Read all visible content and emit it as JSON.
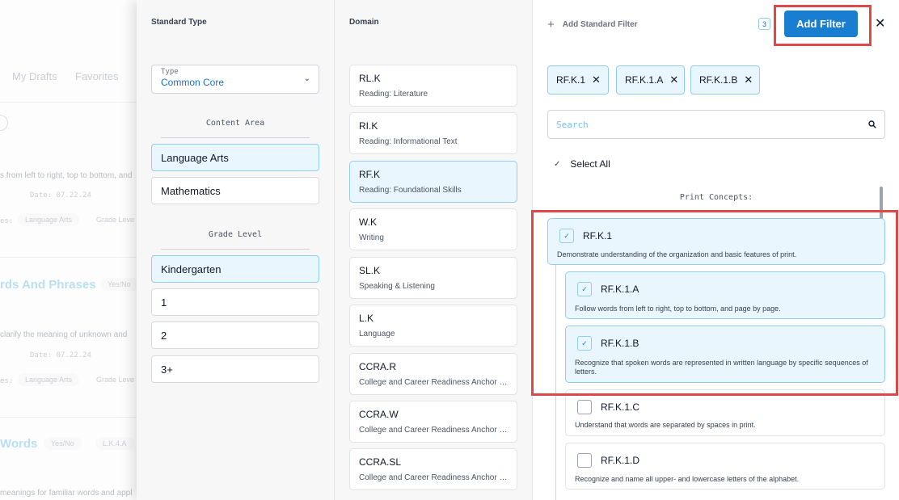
{
  "background": {
    "tabs": [
      "My Drafts",
      "Favorites"
    ],
    "lines": [
      {
        "text": "s from left to right, top to bottom, and",
        "style": "text"
      },
      {
        "text": "Date: 07.22.24",
        "style": "mono"
      },
      {
        "text": "es: ",
        "style": "mono"
      },
      {
        "text": "rds And Phrases",
        "style": "title"
      },
      {
        "text": "clarify the meaning of unknown and",
        "style": "text"
      },
      {
        "text": "Date: 07.22.24",
        "style": "mono"
      },
      {
        "text": "es: ",
        "style": "mono"
      },
      {
        "text": "Words",
        "style": "title"
      },
      {
        "text": "meanings for familiar words and appl",
        "style": "text"
      }
    ],
    "chips": [
      "Language Arts",
      "Grade Leve",
      "Yes/No",
      "Language Arts",
      "Grade Leve",
      "Yes/No",
      "L.K.4.A"
    ]
  },
  "standard_type": {
    "header": "Standard Type",
    "type_select": {
      "label": "Type",
      "value": "Common Core"
    },
    "content_area": {
      "label": "Content Area",
      "options": [
        {
          "label": "Language Arts",
          "selected": true
        },
        {
          "label": "Mathematics",
          "selected": false
        }
      ]
    },
    "grade_level": {
      "label": "Grade Level",
      "options": [
        {
          "label": "Kindergarten",
          "selected": true
        },
        {
          "label": "1",
          "selected": false
        },
        {
          "label": "2",
          "selected": false
        },
        {
          "label": "3+",
          "selected": false
        }
      ]
    }
  },
  "domain": {
    "header": "Domain",
    "items": [
      {
        "code": "RL.K",
        "desc": "Reading: Literature",
        "selected": false
      },
      {
        "code": "RI.K",
        "desc": "Reading: Informational Text",
        "selected": false
      },
      {
        "code": "RF.K",
        "desc": "Reading: Foundational Skills",
        "selected": true
      },
      {
        "code": "W.K",
        "desc": "Writing",
        "selected": false
      },
      {
        "code": "SL.K",
        "desc": "Speaking & Listening",
        "selected": false
      },
      {
        "code": "L.K",
        "desc": "Language",
        "selected": false
      },
      {
        "code": "CCRA.R",
        "desc": "College and Career Readiness Anchor S...",
        "selected": false
      },
      {
        "code": "CCRA.W",
        "desc": "College and Career Readiness Anchor S...",
        "selected": false
      },
      {
        "code": "CCRA.SL",
        "desc": "College and Career Readiness Anchor S...",
        "selected": false
      }
    ]
  },
  "filter": {
    "add_standard_filter": "Add Standard Filter",
    "selected_count": "3",
    "add_filter_button": "Add Filter",
    "chips": [
      "RF.K.1",
      "RF.K.1.A",
      "RF.K.1.B"
    ],
    "search_placeholder": "Search",
    "select_all": "Select All",
    "group_label": "Print Concepts:",
    "standards": [
      {
        "code": "RF.K.1",
        "desc": "Demonstrate understanding of the organization and basic features of print.",
        "checked": true
      },
      {
        "code": "RF.K.1.A",
        "desc": "Follow words from left to right, top to bottom, and page by page.",
        "checked": true
      },
      {
        "code": "RF.K.1.B",
        "desc": "Recognize that spoken words are represented in written language by specific sequences of letters.",
        "checked": true
      },
      {
        "code": "RF.K.1.C",
        "desc": "Understand that words are separated by spaces in print.",
        "checked": false
      },
      {
        "code": "RF.K.1.D",
        "desc": "Recognize and name all upper- and lowercase letters of the alphabet.",
        "checked": false
      }
    ]
  },
  "colors": {
    "accent": "#1a7ed0",
    "selected_bg": "#eaf6fd",
    "highlight": "#e04848"
  }
}
